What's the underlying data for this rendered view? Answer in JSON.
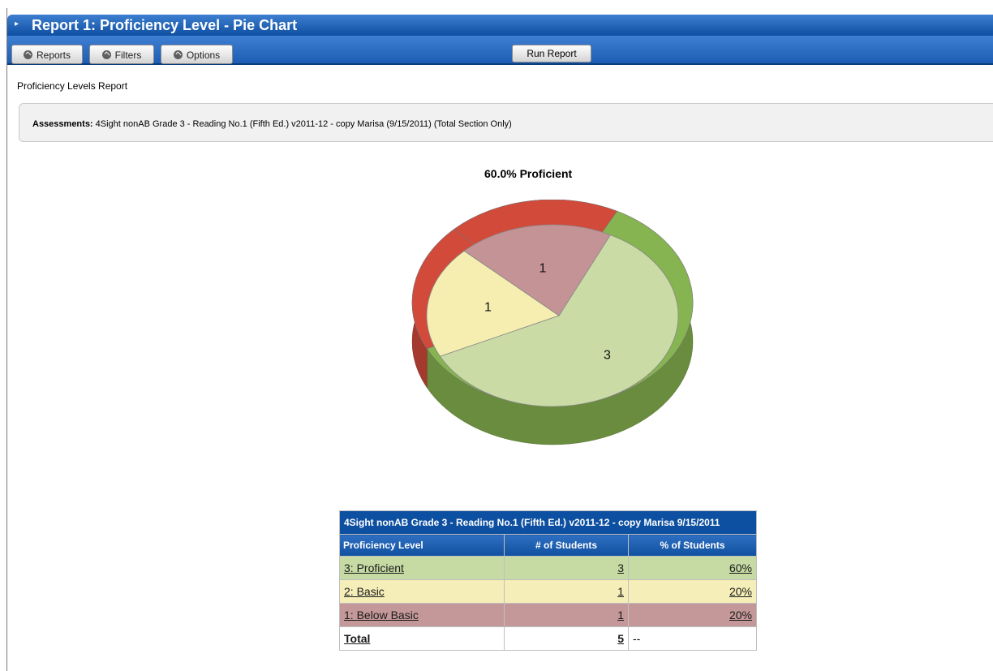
{
  "header": {
    "title": "Report 1: Proficiency Level - Pie Chart"
  },
  "toolbar": {
    "reports_label": "Reports",
    "filters_label": "Filters",
    "options_label": "Options",
    "run_label": "Run Report"
  },
  "report": {
    "name": "Proficiency Levels Report",
    "assessments_label": "Assessments:",
    "assessments_value": "4Sight nonAB Grade 3 - Reading No.1 (Fifth Ed.) v2011-12 - copy Marisa (9/15/2011) (Total Section Only)"
  },
  "chart_data": {
    "type": "pie",
    "title_value": "60.0%",
    "title_label": "Proficient",
    "categories": [
      "3: Proficient",
      "2: Basic",
      "1: Below Basic"
    ],
    "values": [
      3,
      1,
      1
    ],
    "colors": [
      "#cadba5",
      "#f5eeb0",
      "#c49396"
    ],
    "ring_colors": [
      "#86b450",
      "#d24a3a"
    ]
  },
  "table": {
    "caption": "4Sight nonAB Grade 3 - Reading No.1 (Fifth Ed.) v2011-12 - copy Marisa 9/15/2011",
    "headers": [
      "Proficiency Level",
      "# of Students",
      "% of Students"
    ],
    "rows": [
      {
        "level": "3: Proficient",
        "count": "3",
        "percent": "60%"
      },
      {
        "level": "2: Basic",
        "count": "1",
        "percent": "20%"
      },
      {
        "level": "1: Below Basic",
        "count": "1",
        "percent": "20%"
      }
    ],
    "total": {
      "label": "Total",
      "count": "5",
      "percent": "--"
    }
  }
}
